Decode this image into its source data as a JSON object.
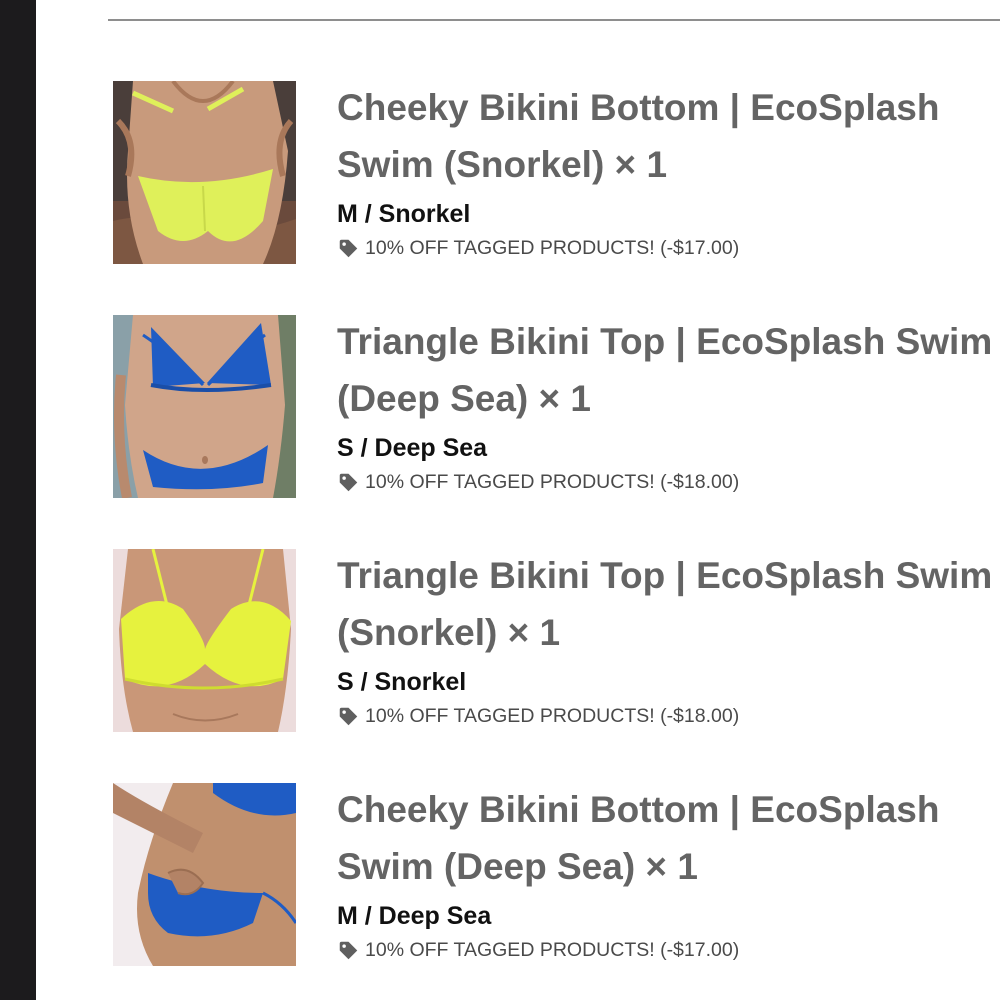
{
  "cart": {
    "items": [
      {
        "title": "Cheeky Bikini Bottom | EcoSplash Swim (Snorkel) × 1",
        "variant": "M / Snorkel",
        "discount": "10% OFF TAGGED PRODUCTS! (-$17.00)",
        "image": {
          "subject": "bikini-bottom",
          "bg": "#4a3e3a",
          "skin": "#c89a7c",
          "garment": "#dff05a"
        }
      },
      {
        "title": "Triangle Bikini Top | EcoSplash Swim (Deep Sea) × 1",
        "variant": "S / Deep Sea",
        "discount": "10% OFF TAGGED PRODUCTS! (-$18.00)",
        "image": {
          "subject": "bikini-top-and-bottom",
          "bg": "#8aa0a8",
          "skin": "#d0a58a",
          "garment": "#1f5cc4"
        }
      },
      {
        "title": "Triangle Bikini Top | EcoSplash Swim (Snorkel) × 1",
        "variant": "S / Snorkel",
        "discount": "10% OFF TAGGED PRODUCTS! (-$18.00)",
        "image": {
          "subject": "bikini-top",
          "bg": "#ecdcdc",
          "skin": "#c99778",
          "garment": "#e6f23e"
        }
      },
      {
        "title": "Cheeky Bikini Bottom | EcoSplash Swim (Deep Sea) × 1",
        "variant": "M / Deep Sea",
        "discount": "10% OFF TAGGED PRODUCTS! (-$17.00)",
        "image": {
          "subject": "bikini-bottom-side",
          "bg": "#f2ecee",
          "skin": "#c0906e",
          "garment": "#1f5cc4"
        }
      }
    ]
  },
  "icons": {
    "discount_tag": "tag-icon"
  },
  "colors": {
    "title": "#646464",
    "variant": "#111111",
    "discount_text": "#4a4a4a",
    "side_bar": "#1c1b1d",
    "divider": "#8e8e8e"
  }
}
